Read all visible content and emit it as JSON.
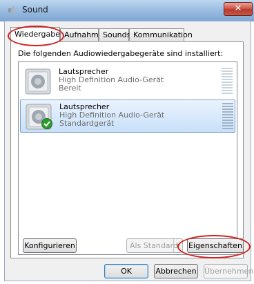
{
  "window": {
    "title": "Sound"
  },
  "tabs": [
    "Wiedergabe",
    "Aufnahme",
    "Sounds",
    "Kommunikation"
  ],
  "panel": {
    "caption": "Die folgenden Audiowiedergabegeräte sind installiert:"
  },
  "devices": [
    {
      "name": "Lautsprecher",
      "driver": "High Definition Audio-Gerät",
      "status": "Bereit",
      "selected": false
    },
    {
      "name": "Lautsprecher",
      "driver": "High Definition Audio-Gerät",
      "status": "Standardgerät",
      "selected": true
    }
  ],
  "buttons": {
    "configure": "Konfigurieren",
    "set_default": "Als Standard",
    "properties": "Eigenschaften",
    "ok": "OK",
    "cancel": "Abbrechen",
    "apply": "Übernehmen"
  },
  "icons": {
    "title": "speaker-icon",
    "device": "speaker-icon",
    "default_badge": "checkmark-icon",
    "close": "close-icon"
  }
}
